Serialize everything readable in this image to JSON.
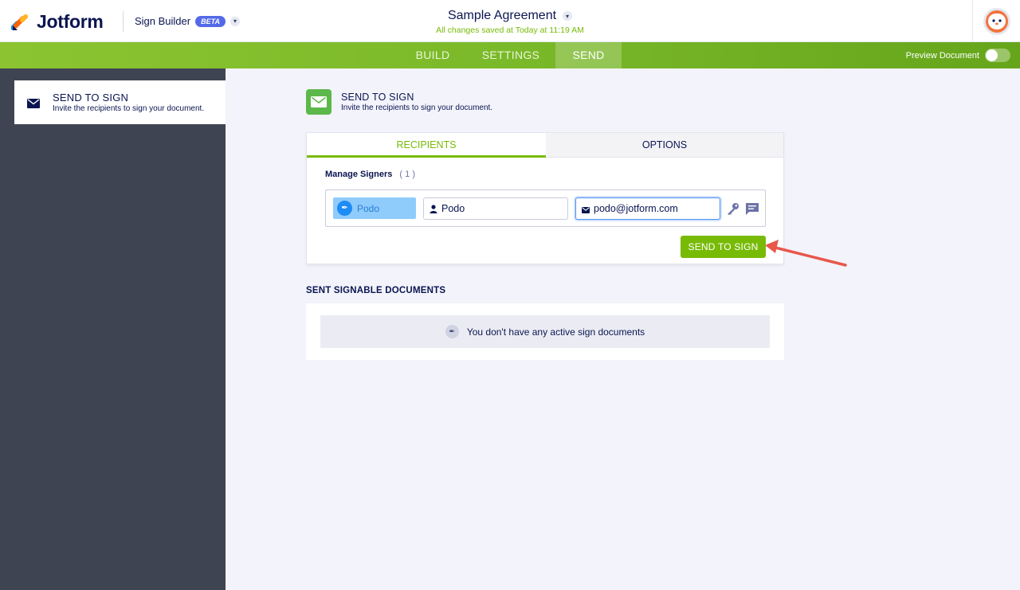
{
  "header": {
    "logo_text": "Jotform",
    "product": "Sign Builder",
    "beta": "BETA",
    "document_title": "Sample Agreement",
    "saved_status": "All changes saved at Today at 11:19 AM"
  },
  "nav": {
    "tabs": [
      {
        "label": "BUILD"
      },
      {
        "label": "SETTINGS"
      },
      {
        "label": "SEND",
        "active": true
      }
    ],
    "preview_label": "Preview Document",
    "preview_on": false
  },
  "sidebar": {
    "items": [
      {
        "title": "SEND TO SIGN",
        "subtitle": "Invite the recipients to sign your document.",
        "icon": "envelope-icon"
      }
    ]
  },
  "main": {
    "title": "SEND TO SIGN",
    "subtitle": "Invite the recipients to sign your document.",
    "tabs": [
      {
        "label": "RECIPIENTS",
        "active": true
      },
      {
        "label": "OPTIONS"
      }
    ],
    "manage_label": "Manage Signers",
    "signer_count": "( 1 )",
    "signer": {
      "role": "Podo",
      "name": "Podo",
      "email": "podo@jotform.com"
    },
    "send_button": "SEND TO SIGN",
    "sent_title": "SENT SIGNABLE DOCUMENTS",
    "empty_message": "You don't have any active sign documents"
  },
  "colors": {
    "brand_green": "#78bb07",
    "navy": "#0a1551",
    "sidebar_bg": "#3e4452",
    "signer_chip": "#8fcbfb",
    "annotation_arrow": "#e8574a"
  }
}
